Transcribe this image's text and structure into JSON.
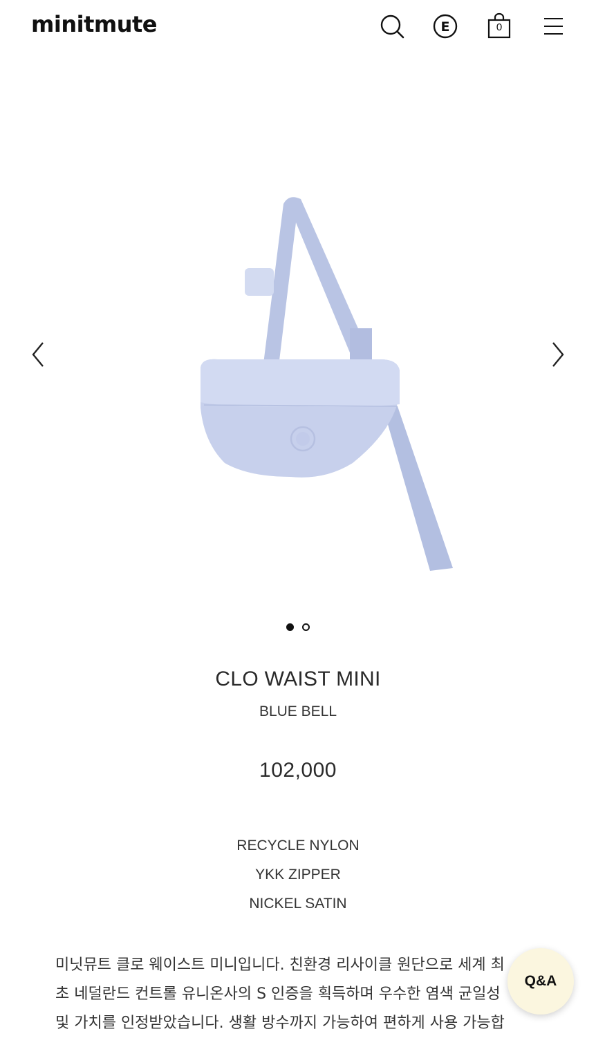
{
  "header": {
    "logo": "minitmute",
    "cart_count": "0",
    "icons": [
      "search-icon",
      "e-logo-icon",
      "cart-bag-icon",
      "hamburger-menu-icon"
    ]
  },
  "carousel": {
    "slide_count": 2,
    "active_slide": 1,
    "image": "blue-bell-waist-bag"
  },
  "product": {
    "name": "CLO WAIST MINI",
    "color": "BLUE BELL",
    "price": "102,000",
    "specs": [
      "RECYCLE NYLON",
      "YKK ZIPPER",
      "NICKEL SATIN"
    ],
    "description_lines": [
      "미닛뮤트 클로 웨이스트 미니입니다. 친환경 리사이클 원단으로 세계 최",
      "초 네덜란드 컨트롤 유니온사의 S 인증을 획득하며 우수한 염색 균일성",
      "및 가치를 인정받았습니다. 생활 방수까지 가능하여 편하게 사용 가능합"
    ]
  },
  "qa_button": {
    "label": "Q&A"
  },
  "colors": {
    "bag": "#c4cde8",
    "strap": "#b7c2e3",
    "qa_bg": "#fbf6df"
  }
}
